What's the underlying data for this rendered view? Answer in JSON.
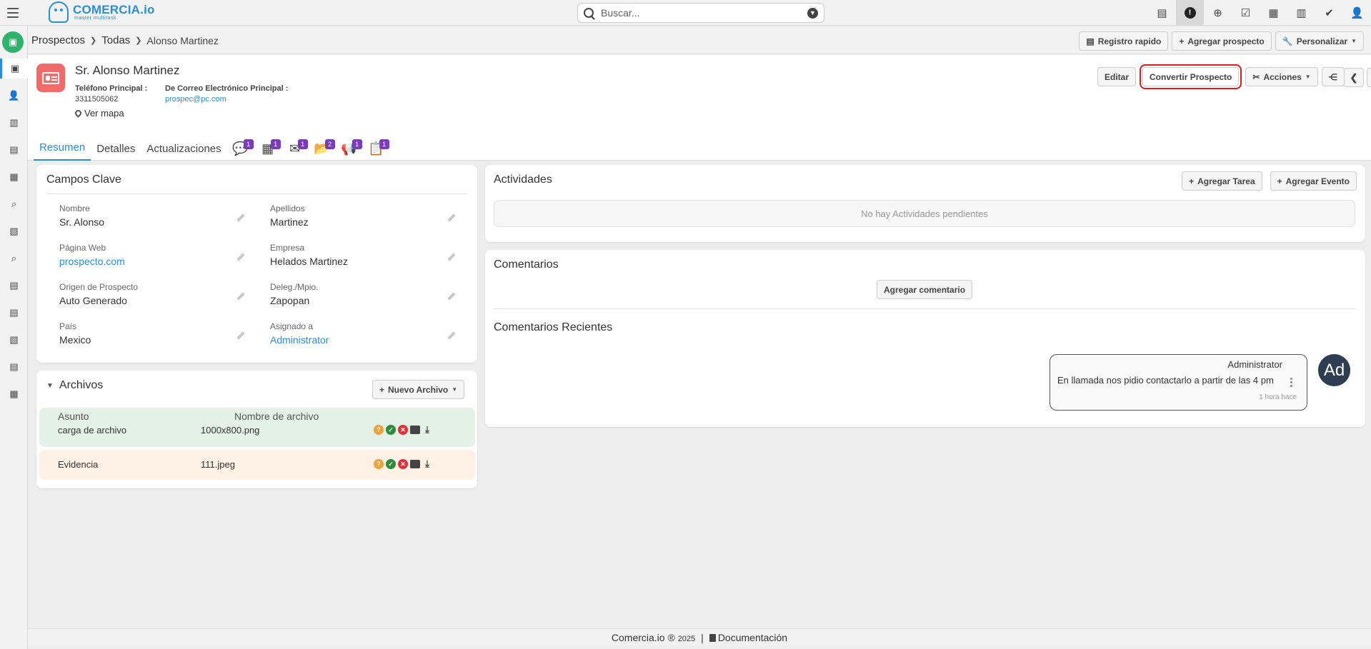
{
  "app": {
    "logo_text": "COMERCIA.io",
    "logo_sub": "master multitask",
    "accent": "#2a8fd8"
  },
  "search": {
    "placeholder": "Buscar..."
  },
  "breadcrumb": {
    "module": "Prospectos",
    "filter": "Todas",
    "current": "Alonso Martinez"
  },
  "toolbar": {
    "quick_register": "Registro rapido",
    "add_prospect": "Agregar prospecto",
    "customize": "Personalizar"
  },
  "record": {
    "name": "Sr. Alonso Martinez",
    "phone_label": "Teléfono Principal :",
    "phone": "3311505062",
    "email_label": "De Correo Electrónico Principal :",
    "email": "prospec@pc.com",
    "map_link": "Ver mapa",
    "edit": "Editar",
    "convert": "Convertir Prospecto",
    "actions": "Acciones"
  },
  "tabs": [
    {
      "label": "Resumen"
    },
    {
      "label": "Detalles"
    },
    {
      "label": "Actualizaciones"
    }
  ],
  "tab_icons": [
    {
      "icon": "comments-icon",
      "glyph": "💬",
      "count": "1"
    },
    {
      "icon": "calendar-icon",
      "glyph": "▦",
      "count": "1"
    },
    {
      "icon": "mail-icon",
      "glyph": "✉",
      "count": "1"
    },
    {
      "icon": "folder-icon",
      "glyph": "📂",
      "count": "2"
    },
    {
      "icon": "campaign-icon",
      "glyph": "📢",
      "count": "1"
    },
    {
      "icon": "document-icon",
      "glyph": "📋",
      "count": "1"
    }
  ],
  "key_fields": {
    "title": "Campos Clave",
    "fields": [
      {
        "label": "Nombre",
        "value": "Sr. Alonso"
      },
      {
        "label": "Apellidos",
        "value": "Martinez"
      },
      {
        "label": "Página Web",
        "value": "prospecto.com"
      },
      {
        "label": "Empresa",
        "value": "Helados Martinez"
      },
      {
        "label": "Origen de Prospecto",
        "value": "Auto Generado"
      },
      {
        "label": "Deleg./Mpio.",
        "value": "Zapopan"
      },
      {
        "label": "País",
        "value": "Mexico"
      },
      {
        "label": "Asignado a",
        "value": "Administrator"
      }
    ]
  },
  "files": {
    "title": "Archivos",
    "new_button": "Nuevo Archivo",
    "col_subject": "Asunto",
    "col_filename": "Nombre de archivo",
    "rows": [
      {
        "subject": "carga de archivo",
        "filename": "1000x800.png"
      },
      {
        "subject": "Evidencia",
        "filename": "111.jpeg"
      }
    ]
  },
  "activities": {
    "title": "Actividades",
    "add_task": "Agregar Tarea",
    "add_event": "Agregar Evento",
    "empty": "No hay Actividades pendientes"
  },
  "comments": {
    "title": "Comentarios",
    "add_button": "Agregar comentario",
    "recent_title": "Comentarios Recientes",
    "items": [
      {
        "author": "Administrator",
        "text": "En llamada nos pidio contactarlo a partir de las 4 pm",
        "time": "1 hora hace",
        "avatar": "Ad"
      }
    ]
  },
  "footer": {
    "brand": "Comercia.io ®",
    "year": "2025",
    "docs": "Documentación"
  }
}
